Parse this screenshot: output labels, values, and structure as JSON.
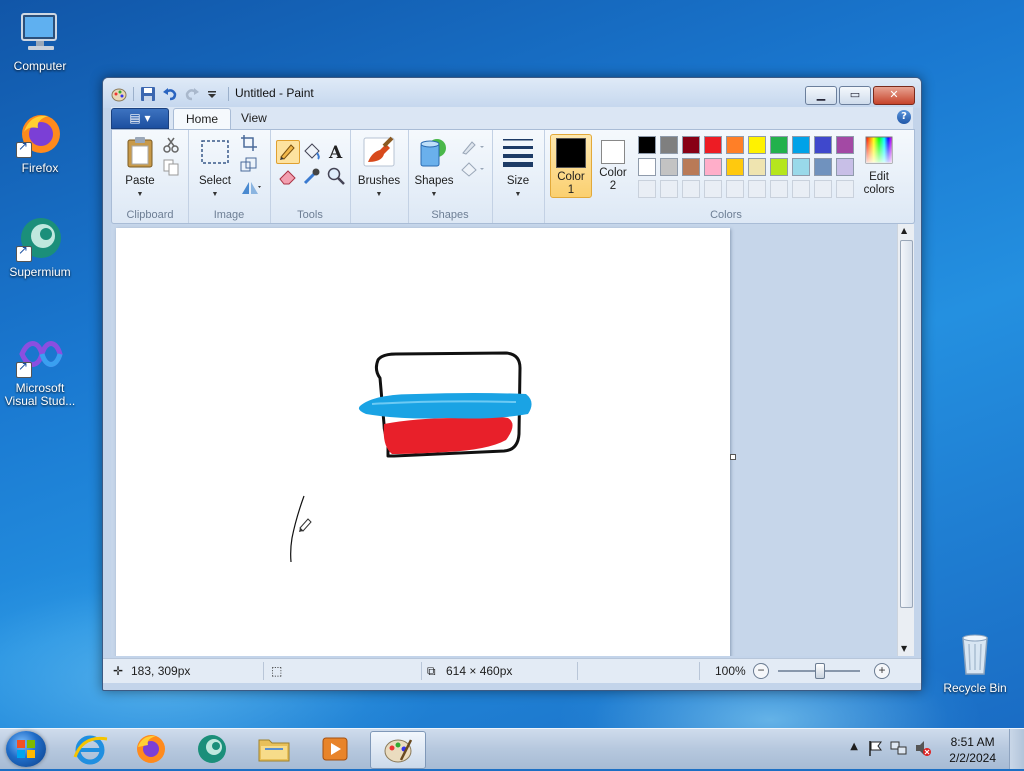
{
  "desktop": {
    "icons": [
      {
        "label": "Computer"
      },
      {
        "label": "Firefox"
      },
      {
        "label": "Supermium"
      },
      {
        "label": "Microsoft Visual Stud..."
      },
      {
        "label": "Recycle Bin"
      }
    ]
  },
  "window": {
    "title": "Untitled - Paint",
    "tabs": [
      {
        "label": "Home",
        "active": true
      },
      {
        "label": "View",
        "active": false
      }
    ],
    "help_label": "?",
    "ribbon": {
      "clipboard": {
        "label": "Clipboard",
        "paste": "Paste"
      },
      "image": {
        "label": "Image",
        "select": "Select"
      },
      "tools": {
        "label": "Tools"
      },
      "shapes": {
        "label": "Shapes",
        "brushes": "Brushes",
        "shapes_btn": "Shapes"
      },
      "size": {
        "label": "Size"
      },
      "colors": {
        "label": "Colors",
        "color1_line1": "Color",
        "color1_line2": "1",
        "color2_line1": "Color",
        "color2_line2": "2",
        "edit_line1": "Edit",
        "edit_line2": "colors",
        "color1": "#000000",
        "color2": "#ffffff",
        "palette_row1": [
          "#000000",
          "#7f7f7f",
          "#880015",
          "#ed1c24",
          "#ff7f27",
          "#fff200",
          "#22b14c",
          "#00a2e8",
          "#3f48cc",
          "#a349a4"
        ],
        "palette_row2": [
          "#ffffff",
          "#c3c3c3",
          "#b97a57",
          "#ffaec9",
          "#ffc90e",
          "#efe4b0",
          "#b5e61d",
          "#99d9ea",
          "#7092be",
          "#c8bfe7"
        ]
      }
    },
    "status": {
      "cursor_pos": "183, 309px",
      "canvas_size": "614 × 460px",
      "zoom": "100%"
    }
  },
  "taskbar": {
    "clock_time": "8:51 AM",
    "clock_date": "2/2/2024"
  }
}
